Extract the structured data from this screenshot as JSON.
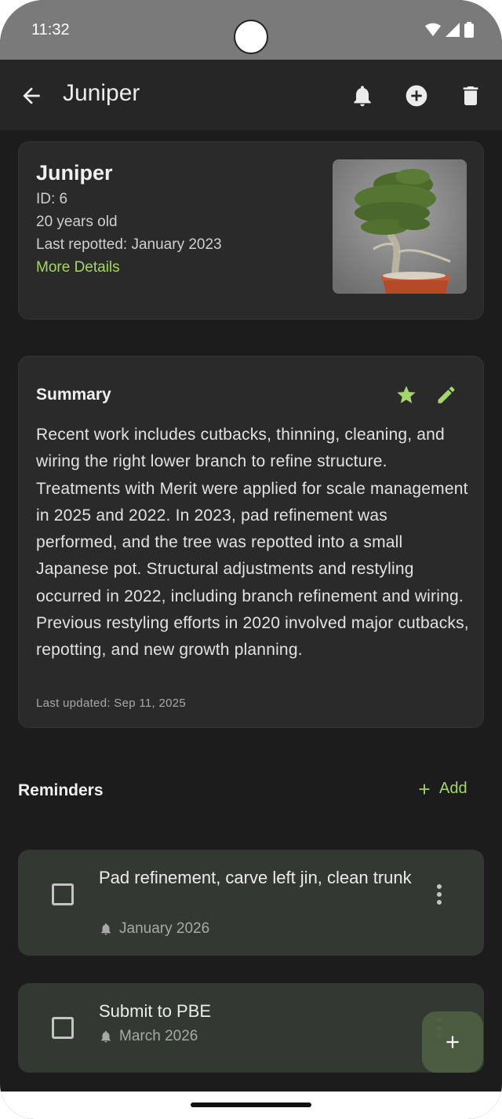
{
  "status_bar": {
    "time": "11:32"
  },
  "app_bar": {
    "title": "Juniper"
  },
  "tree": {
    "name": "Juniper",
    "id_text": "ID: 6",
    "age_text": "20 years old",
    "repot_text": "Last repotted: January 2023",
    "more_details": "More Details"
  },
  "summary": {
    "title": "Summary",
    "body": "Recent work includes cutbacks, thinning, cleaning, and wiring the right lower branch to refine structure. Treatments with Merit were applied for scale management in 2025 and 2022. In 2023, pad refinement was performed, and the tree was repotted into a small Japanese pot. Structural adjustments and restyling occurred in 2022, including branch refinement and wiring. Previous restyling efforts in 2020 involved major cutbacks, repotting, and new growth planning.",
    "updated": "Last updated: Sep 11, 2025"
  },
  "reminders": {
    "title": "Reminders",
    "add_label": "Add",
    "items": [
      {
        "title": "Pad refinement, carve left jin, clean trunk",
        "date": "January 2026"
      },
      {
        "title": "Submit to PBE",
        "date": "March 2026"
      }
    ]
  },
  "colors": {
    "accent": "#a5d66b",
    "background": "#1c1c1c",
    "card": "#2a2a2a",
    "reminder_card": "#343832"
  },
  "icons": [
    "back-arrow-icon",
    "bell-icon",
    "add-circle-icon",
    "trash-icon",
    "star-icon",
    "pencil-icon",
    "plus-icon",
    "checkbox-icon",
    "kebab-icon"
  ]
}
